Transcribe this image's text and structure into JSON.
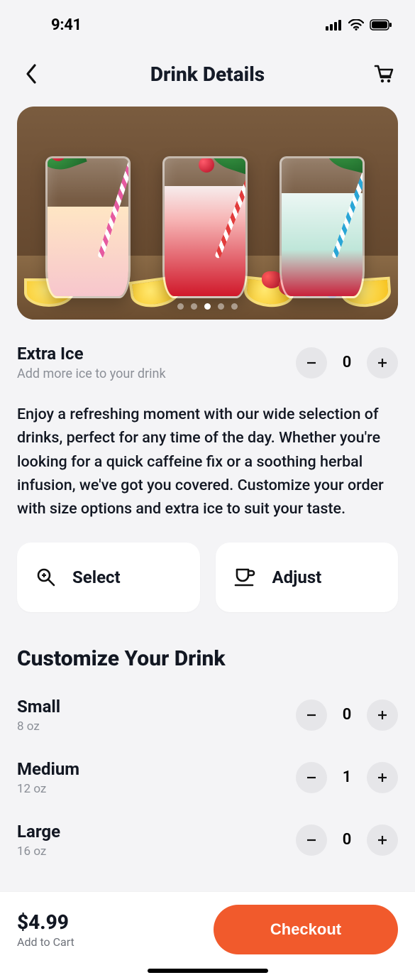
{
  "status": {
    "time": "9:41"
  },
  "header": {
    "title": "Drink Details"
  },
  "hero": {
    "dot_count": 5,
    "active_dot": 2
  },
  "extra": {
    "title": "Extra Ice",
    "subtitle": "Add more ice to your drink",
    "value": "0"
  },
  "description": "Enjoy a refreshing moment with our wide selection of drinks, perfect for any time of the day. Whether you're looking for a quick caffeine fix or a soothing herbal infusion, we've got you covered. Customize your order with size options and extra ice to suit your taste.",
  "actions": {
    "select": "Select",
    "adjust": "Adjust"
  },
  "customize_heading": "Customize Your Drink",
  "sizes": [
    {
      "name": "Small",
      "detail": "8 oz",
      "value": "0"
    },
    {
      "name": "Medium",
      "detail": "12 oz",
      "value": "1"
    },
    {
      "name": "Large",
      "detail": "16 oz",
      "value": "0"
    }
  ],
  "footer": {
    "price": "$4.99",
    "subtext": "Add to Cart",
    "cta": "Checkout"
  }
}
